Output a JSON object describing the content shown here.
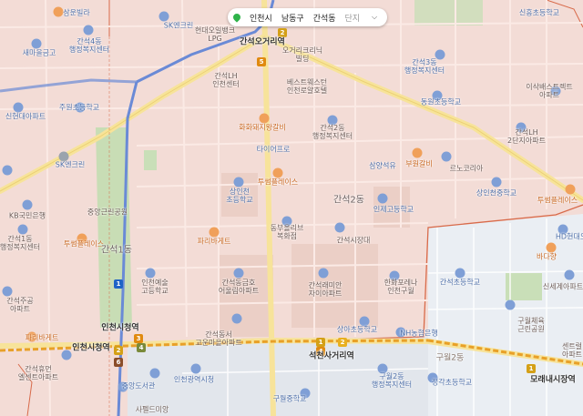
{
  "breadcrumb": {
    "city": "인천시",
    "district": "남동구",
    "dong": "간석동",
    "complex": "단지"
  },
  "labels": {
    "samyang_villa": "삼운빌라",
    "saemaeul": "새마을금고",
    "ganseok4_center": "간석4동\n행정복지센터",
    "sk_hyundai": "SK엔크린",
    "hyundai_lpg": "현대오일뱅크\nLPG",
    "ganseok5_station": "간석오거리역",
    "ohgeori_villa": "오거리크리닉\n빌딩",
    "ganseok3_center": "간석3동\n행정복지센터",
    "sinheung_school": "신흥초등학교",
    "juwon": "주원초등학교",
    "sinhyeon_apt": "신현대아파트",
    "lh_center": "간석LH\n인천센터",
    "best_center": "베스트웨스턴\n인천로얄호텔",
    "dongwon_school": "동원초등학교",
    "iksan_apt": "이삭배스트렉트\n아파트",
    "sk_enclean": "SK엔크린",
    "hwarang_galbi": "화화돼지왕갈비",
    "ganseok2_center": "간석2동\n행정복지센터",
    "ganseok_lh2": "간석LH\n2단지아파트",
    "tiger_pro": "타이어프로",
    "samyang_seok": "삼양석유",
    "bugeun_galbi": "부원갈비",
    "erukorea": "르노코리아",
    "tuim_place": "투썸플레이스",
    "sangin_school": "상인천\n초등학교",
    "ganseok2dong": "간석2동",
    "incheon_jungang": "인제고등학교",
    "sangin_middle": "상인천중학교",
    "tuim_place2": "투썸플레이스",
    "kb_bank": "KB국민은행",
    "jungang_bank": "중앙근린공원",
    "dongbu_general": "동부올리브\n복화점",
    "ganseok1_center": "간석1동\n행정복지센터",
    "tuimpl3": "투썸플레이스",
    "paris": "파리바게트",
    "ganseok_market": "간석시장대",
    "hd_incheon": "HD현대오",
    "bada": "바다향",
    "ganseok1dong": "간석1동",
    "incheon_art": "인천예술\n고등학교",
    "ganseok_gold": "간석동금호\n어울림아파트",
    "ganseok_raemian": "간석래미안\n자이아파트",
    "hanwha": "한화포레나\n인천구월",
    "ganseok_elementary": "간석초등학교",
    "sinsegye_apt": "신세계아파트",
    "ganseok_apt": "간석주공\n아파트",
    "ganseok_huil": "간석휴먼\n엘센트아파트",
    "incheon_city_station": "인천시청역",
    "sangseong_school": "상아초등학교",
    "nh_bank": "NH농협은행",
    "guwol_gym": "구월체육\n근린공원",
    "sentum": "센트럴\n아파트",
    "paris2": "파리바게트",
    "incheon_city_station2": "인천시청역",
    "ganseok_st": "간석동서\n고운마을아파트",
    "guwol2": "구월2동",
    "ganseok_ohgeori": "석천사거리역",
    "guwol2_center": "구월2동\n행정복지센터",
    "morae": "모래내시장역",
    "incheon_cityhall": "인천광역시청",
    "jungang_dosi": "중앙도서관",
    "guwol_middle": "구월중학교",
    "jeonggak": "정각초등학교",
    "sapeul": "사펠드미앙"
  }
}
